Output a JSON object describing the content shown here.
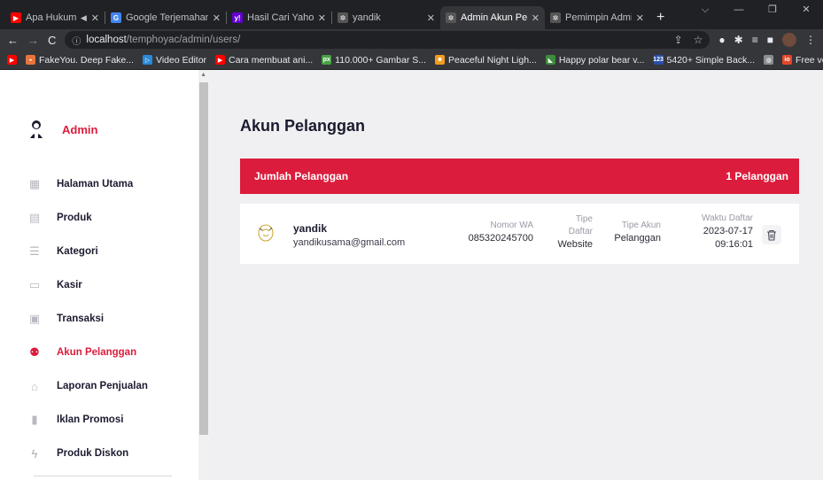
{
  "browser": {
    "tabs": [
      {
        "title": "Apa Hukum M",
        "icon": "youtube-icon",
        "color": "#ff0000",
        "glyph": "▶",
        "extra": "◀"
      },
      {
        "title": "Google Terjemahan",
        "icon": "google-translate-icon",
        "color": "#4285f4",
        "glyph": "G"
      },
      {
        "title": "Hasil Cari Yahoo un",
        "icon": "yahoo-icon",
        "color": "#6001d2",
        "glyph": "y!"
      },
      {
        "title": "yandik",
        "icon": "site-icon",
        "color": "#555555",
        "glyph": "✲"
      },
      {
        "title": "Admin Akun Pelang",
        "icon": "site-icon",
        "color": "#555555",
        "glyph": "✲",
        "active": true
      },
      {
        "title": "Pemimpin Admin A",
        "icon": "site-icon",
        "color": "#555555",
        "glyph": "✲"
      }
    ],
    "new_tab": "+",
    "url_host": "localhost",
    "url_path": "/temphoyac/admin/users/",
    "bookmarks": [
      {
        "label": "",
        "color": "#ff0000",
        "glyph": "▶"
      },
      {
        "label": "FakeYou. Deep Fake...",
        "color": "#e8743b",
        "glyph": "◒"
      },
      {
        "label": "Video Editor",
        "color": "#2b88d8",
        "glyph": "▷"
      },
      {
        "label": "Cara membuat ani...",
        "color": "#ff0000",
        "glyph": "▶"
      },
      {
        "label": "110.000+ Gambar S...",
        "color": "#47a147",
        "glyph": "px"
      },
      {
        "label": "Peaceful Night Ligh...",
        "color": "#f29b1d",
        "glyph": "☻"
      },
      {
        "label": "Happy polar bear v...",
        "color": "#3c8d3c",
        "glyph": "◣"
      },
      {
        "label": "5420+ Simple Back...",
        "color": "#2b4fa8",
        "glyph": "123"
      },
      {
        "label": "",
        "color": "#8a8d91",
        "glyph": "◍"
      },
      {
        "label": "Free vector \"Vector...",
        "color": "#e4462b",
        "glyph": "io"
      }
    ],
    "more_bookmarks": "»"
  },
  "sidebar": {
    "brand": "Admin",
    "items": [
      {
        "label": "Halaman Utama",
        "icon": "dashboard-icon",
        "glyph": "▦"
      },
      {
        "label": "Produk",
        "icon": "box-icon",
        "glyph": "▤"
      },
      {
        "label": "Kategori",
        "icon": "list-icon",
        "glyph": "☰"
      },
      {
        "label": "Kasir",
        "icon": "monitor-icon",
        "glyph": "▭"
      },
      {
        "label": "Transaksi",
        "icon": "bag-icon",
        "glyph": "▣"
      },
      {
        "label": "Akun Pelanggan",
        "icon": "users-icon",
        "glyph": "⚉",
        "active": true
      },
      {
        "label": "Laporan Penjualan",
        "icon": "bank-icon",
        "glyph": "⌂"
      },
      {
        "label": "Iklan Promosi",
        "icon": "ad-icon",
        "glyph": "▮"
      },
      {
        "label": "Produk Diskon",
        "icon": "bolt-icon",
        "glyph": "ϟ"
      }
    ]
  },
  "main": {
    "title": "Akun Pelanggan",
    "count_label": "Jumlah Pelanggan",
    "count_value": "1 Pelanggan",
    "customers": [
      {
        "name": "yandik",
        "email": "yandikusama@gmail.com",
        "wa_label": "Nomor WA",
        "wa_value": "085320245700",
        "type_label_1": "Tipe",
        "type_label_2": "Daftar",
        "type_value": "Website",
        "account_label": "Tipe Akun",
        "account_value": "Pelanggan",
        "time_label": "Waktu Daftar",
        "date_value": "2023-07-17",
        "time_value": "09:16:01"
      }
    ]
  },
  "colors": {
    "accent": "#dc1c3c"
  }
}
